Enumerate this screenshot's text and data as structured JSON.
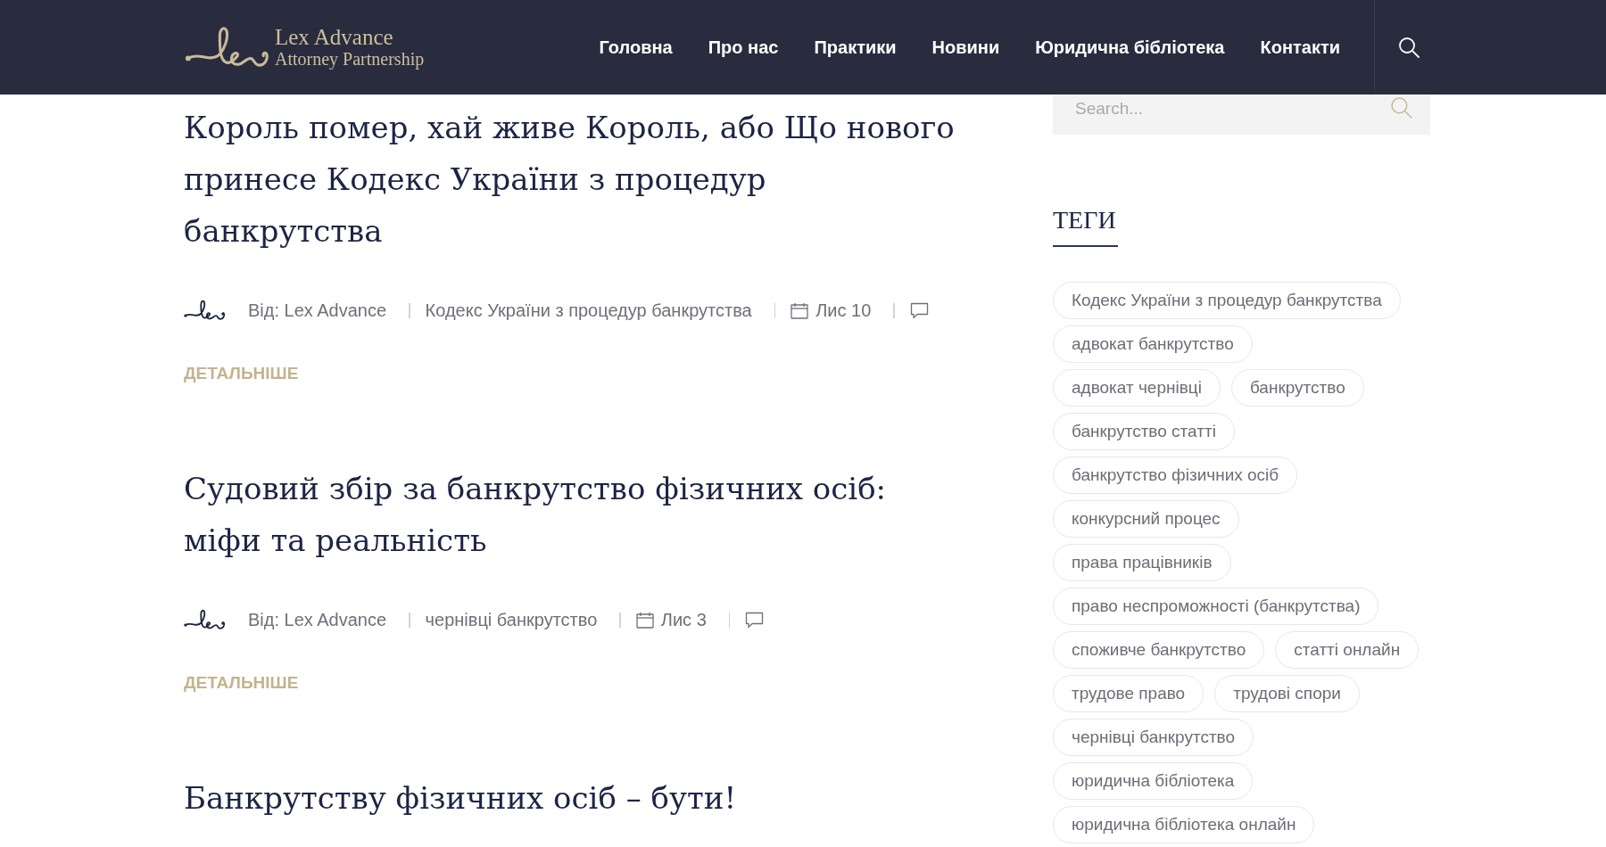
{
  "header": {
    "logo": {
      "name": "Lex Advance",
      "tagline": "Attorney Partnership"
    },
    "nav": [
      "Головна",
      "Про нас",
      "Практики",
      "Новини",
      "Юридична бібліотека",
      "Контакти"
    ]
  },
  "posts": [
    {
      "title": "Король помер, хай живе Король, або Що нового принесе Кодекс України з процедур банкрутства",
      "author": "Від: Lex Advance",
      "category": "Кодекс України з процедур банкрутства",
      "date": "Лис 10",
      "read_more": "ДЕТАЛЬНІШЕ"
    },
    {
      "title": "Судовий збір за банкрутство фізичних осіб: міфи та реальність",
      "author": "Від: Lex Advance",
      "category": "чернівці банкрутство",
      "date": "Лис 3",
      "read_more": "ДЕТАЛЬНІШЕ"
    },
    {
      "title": "Банкрутству фізичних осіб – бути!"
    }
  ],
  "sidebar": {
    "search": {
      "placeholder": "Search..."
    },
    "tags": {
      "title": "ТЕГИ",
      "items": [
        "Кодекс України з процедур банкрутства",
        "адвокат банкрутство",
        "адвокат чернівці",
        "банкрутство",
        "банкрутство статті",
        "банкрутство фізичних осіб",
        "конкурсний процес",
        "права працівників",
        "право неспроможності (банкрутства)",
        "споживче банкрутство",
        "статті онлайн",
        "трудове право",
        "трудові спори",
        "чернівці банкрутство",
        "юридична бібліотека",
        "юридична бібліотека онлайн"
      ]
    }
  }
}
